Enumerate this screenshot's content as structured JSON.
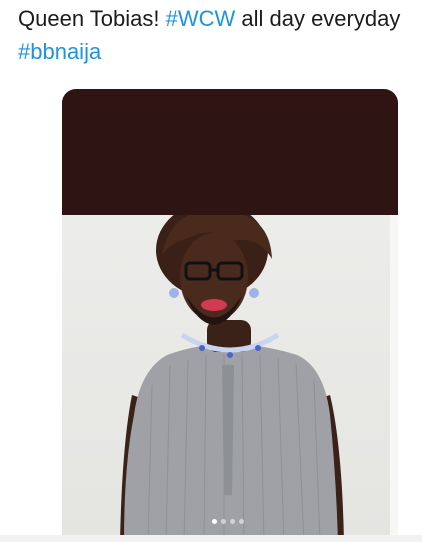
{
  "tweet": {
    "text_prefix": "Queen Tobias! ",
    "hashtag_1": "#WCW",
    "text_middle": " all day everyday",
    "hashtag_2": "#bbnaija"
  },
  "media": {
    "image_description": "Photo edit: man in grey embroidered native attire with a woman's wig, glasses, lipstick, earrings and necklace",
    "carousel_page_count": 4,
    "carousel_active_index": 0
  },
  "colors": {
    "hashtag": "#1b95e0",
    "banner": "#2e1413",
    "outfit": "#9fa1a6"
  }
}
